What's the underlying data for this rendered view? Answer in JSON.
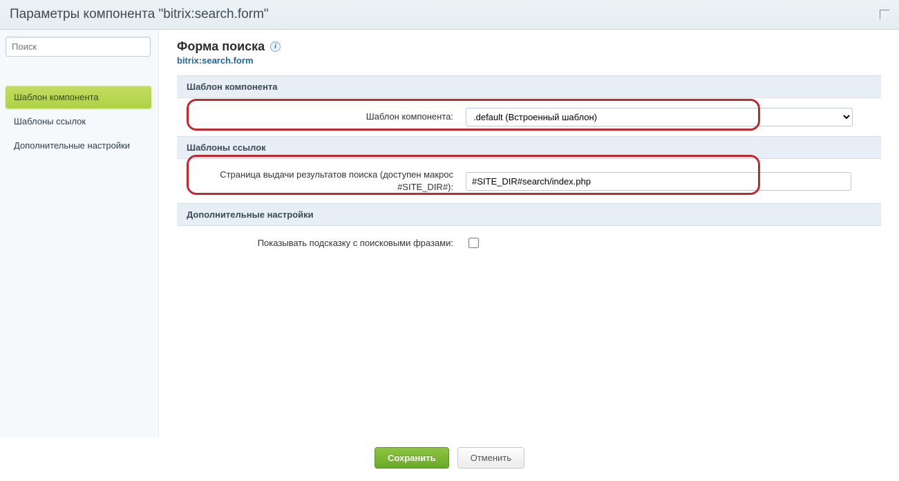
{
  "titlebar": {
    "title": "Параметры компонента \"bitrix:search.form\""
  },
  "sidebar": {
    "search_placeholder": "Поиск",
    "nav": [
      {
        "label": "Шаблон компонента",
        "active": true
      },
      {
        "label": "Шаблоны ссылок",
        "active": false
      },
      {
        "label": "Дополнительные настройки",
        "active": false
      }
    ]
  },
  "header": {
    "title": "Форма поиска",
    "subtitle": "bitrix:search.form"
  },
  "sections": {
    "template": {
      "heading": "Шаблон компонента",
      "field_label": "Шаблон компонента:",
      "selected": ".default (Встроенный шаблон)"
    },
    "links": {
      "heading": "Шаблоны ссылок",
      "field_label": "Страница выдачи результатов поиска (доступен макрос #SITE_DIR#):",
      "value": "#SITE_DIR#search/index.php"
    },
    "extra": {
      "heading": "Дополнительные настройки",
      "field_label": "Показывать подсказку с поисковыми фразами:",
      "checked": false
    }
  },
  "footer": {
    "save": "Сохранить",
    "cancel": "Отменить"
  }
}
